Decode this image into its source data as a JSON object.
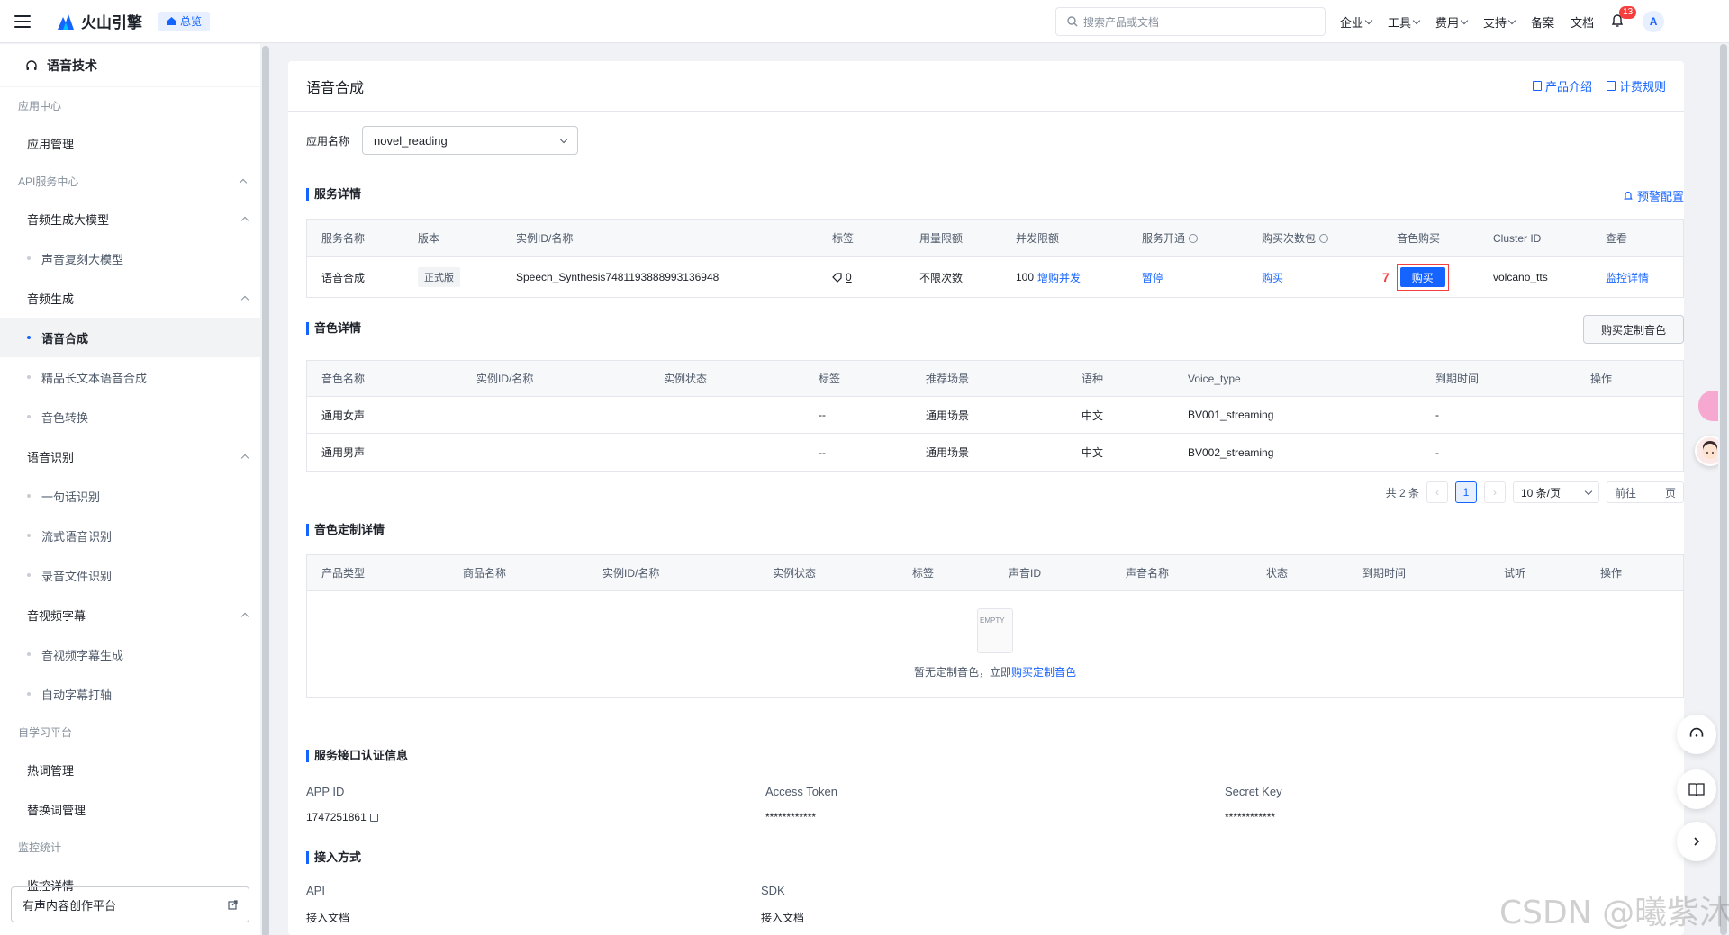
{
  "topbar": {
    "brand": "火山引擎",
    "home_label": "总览",
    "search_placeholder": "搜索产品或文档",
    "nav": [
      "企业",
      "工具",
      "费用",
      "支持"
    ],
    "nav_plain": [
      "备案",
      "文档"
    ],
    "notification_count": "13",
    "avatar_letter": "A"
  },
  "sidebar": {
    "title": "语音技术",
    "groups": [
      {
        "label": "应用中心"
      },
      {
        "label": "API服务中心"
      },
      {
        "label": "自学习平台"
      },
      {
        "label": "监控统计"
      }
    ],
    "items": {
      "app_manage": "应用管理",
      "audio_llm": "音频生成大模型",
      "voice_clone": "声音复刻大模型",
      "audio_gen": "音频生成",
      "tts": "语音合成",
      "long_tts": "精品长文本语音合成",
      "voice_convert": "音色转换",
      "asr": "语音识别",
      "asr_sentence": "一句话识别",
      "asr_stream": "流式语音识别",
      "asr_file": "录音文件识别",
      "subtitle": "音视频字幕",
      "subtitle_gen": "音视频字幕生成",
      "subtitle_align": "自动字幕打轴",
      "hotword": "热词管理",
      "replace_word": "替换词管理",
      "monitor": "监控详情"
    },
    "bottom_link": "有声内容创作平台"
  },
  "page": {
    "title": "语音合成",
    "links": [
      "产品介绍",
      "计费规则"
    ],
    "app_label": "应用名称",
    "app_value": "novel_reading"
  },
  "service": {
    "title": "服务详情",
    "alert_link": "预警配置",
    "headers": [
      "服务名称",
      "版本",
      "实例ID/名称",
      "标签",
      "用量限额",
      "并发限额",
      "服务开通",
      "购买次数包",
      "音色购买",
      "Cluster ID",
      "查看"
    ],
    "row": {
      "name": "语音合成",
      "version": "正式版",
      "instance": "Speech_Synthesis7481193888993136948",
      "tag": "0",
      "quota": "不限次数",
      "concurrency": "100",
      "concurrency_link": "增购并发",
      "open": "暂停",
      "buy_pack": "购买",
      "step": "7",
      "buy_voice": "购买",
      "cluster": "volcano_tts",
      "view": "监控详情"
    }
  },
  "voices": {
    "title": "音色详情",
    "buy_custom_button": "购买定制音色",
    "headers": [
      "音色名称",
      "实例ID/名称",
      "实例状态",
      "标签",
      "推荐场景",
      "语种",
      "Voice_type",
      "到期时间",
      "操作"
    ],
    "rows": [
      {
        "name": "通用女声",
        "instance": "",
        "status": "",
        "tag": "--",
        "scene": "通用场景",
        "lang": "中文",
        "voice_type": "BV001_streaming",
        "expire": "-",
        "op": ""
      },
      {
        "name": "通用男声",
        "instance": "",
        "status": "",
        "tag": "--",
        "scene": "通用场景",
        "lang": "中文",
        "voice_type": "BV002_streaming",
        "expire": "-",
        "op": ""
      }
    ],
    "pager": {
      "total": "共 2 条",
      "current": "1",
      "page_size": "10 条/页",
      "goto": "前往",
      "page_unit": "页"
    }
  },
  "custom": {
    "title": "音色定制详情",
    "headers": [
      "产品类型",
      "商品名称",
      "实例ID/名称",
      "实例状态",
      "标签",
      "声音ID",
      "声音名称",
      "状态",
      "到期时间",
      "试听",
      "操作"
    ],
    "empty_icon_text": "EMPTY",
    "empty_text": "暂无定制音色，立即",
    "empty_link": "购买定制音色"
  },
  "auth": {
    "title": "服务接口认证信息",
    "app_id_label": "APP ID",
    "app_id": "1747251861",
    "token_label": "Access Token",
    "token": "************",
    "secret_label": "Secret Key",
    "secret": "************"
  },
  "access": {
    "title": "接入方式",
    "api_label": "API",
    "api_link": "接入文档",
    "sdk_label": "SDK",
    "sdk_link": "接入文档"
  },
  "watermark": "CSDN @曦紫沐",
  "colors": {
    "accent": "#1664ff",
    "danger": "#f53f3f"
  }
}
